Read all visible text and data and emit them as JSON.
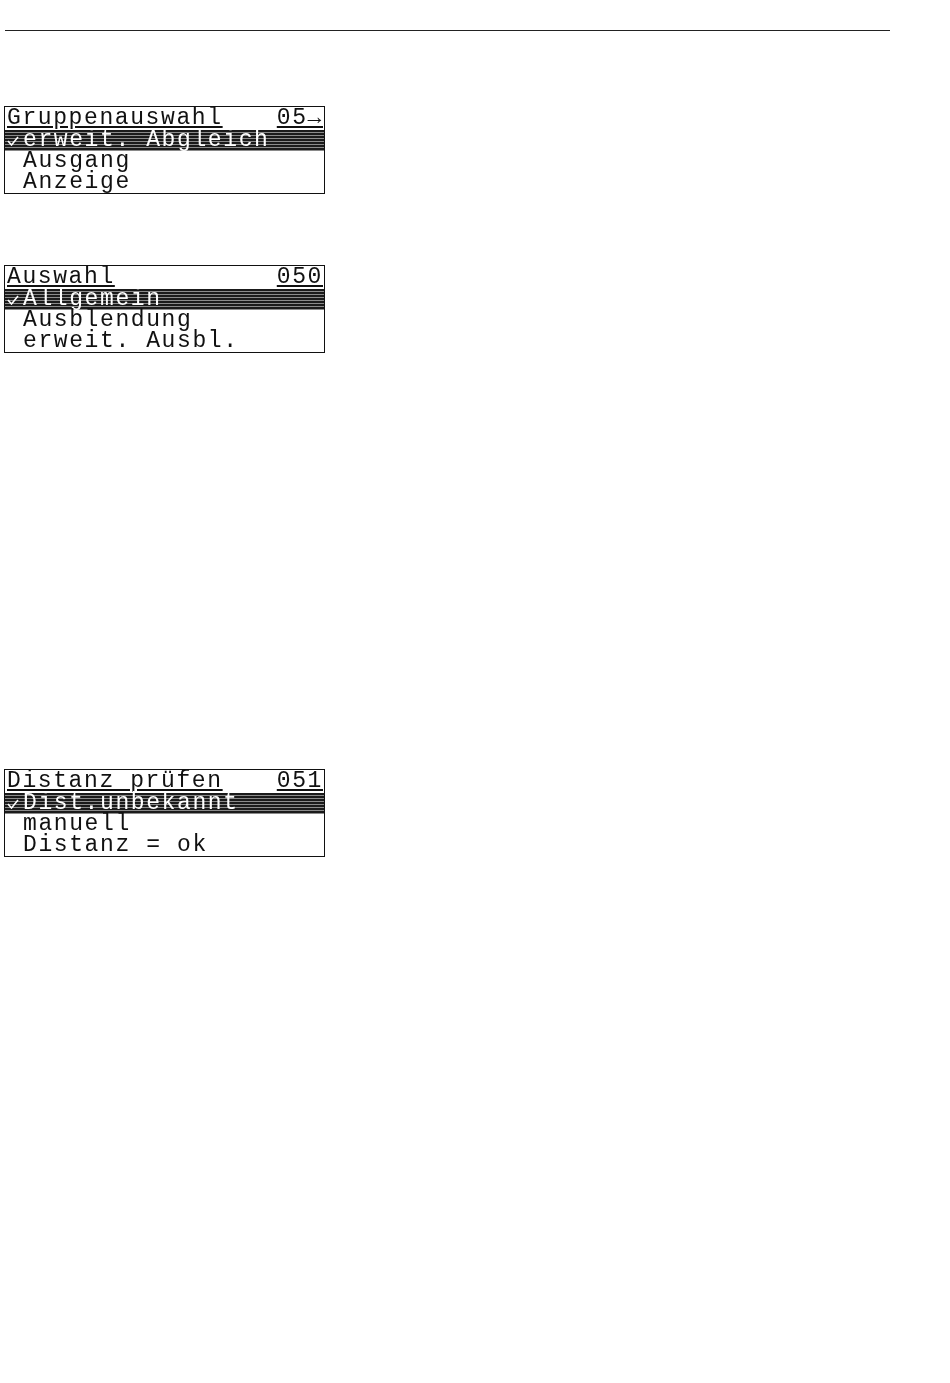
{
  "screens": [
    {
      "title": "Gruppenauswahl",
      "code": "05→",
      "items": [
        {
          "label": "erweit. Abgleich",
          "selected": true
        },
        {
          "label": "Ausgang",
          "selected": false
        },
        {
          "label": "Anzeige",
          "selected": false
        }
      ]
    },
    {
      "title": "Auswahl",
      "code": "050",
      "items": [
        {
          "label": "Allgemein",
          "selected": true
        },
        {
          "label": "Ausblendung",
          "selected": false
        },
        {
          "label": "erweit. Ausbl.",
          "selected": false
        }
      ]
    },
    {
      "title": "Distanz prüfen",
      "code": "051",
      "items": [
        {
          "label": "Dist.unbekannt",
          "selected": true
        },
        {
          "label": "manuell",
          "selected": false
        },
        {
          "label": "Distanz = ok",
          "selected": false
        }
      ]
    }
  ]
}
